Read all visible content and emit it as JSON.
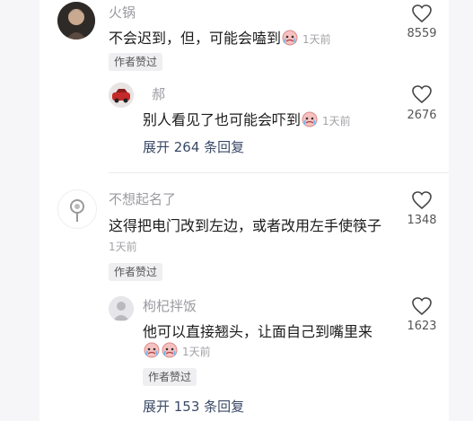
{
  "comments": [
    {
      "name": "火锅",
      "text": "不会迟到，但，可能会嗑到",
      "time": "1天前",
      "badge": "作者赞过",
      "likes": "8559",
      "avatar_icon": "user-photo-avatar",
      "reply": {
        "name": "郝",
        "text": "别人看见了也可能会吓到",
        "time": "1天前",
        "likes": "2676",
        "avatar_icon": "red-car-avatar"
      },
      "expand": "展开 264 条回复"
    },
    {
      "name": "不想起名了",
      "text": "这得把电门改到左边，或者改用左手使筷子",
      "time": "1天前",
      "badge": "作者赞过",
      "likes": "1348",
      "avatar_icon": "lollipop-avatar",
      "reply": {
        "name": "枸杞拌饭",
        "text": "他可以直接翘头，让面自己到嘴里来",
        "time": "1天前",
        "badge": "作者赞过",
        "likes": "1623",
        "avatar_icon": "default-user-avatar"
      },
      "expand": "展开 153 条回复"
    }
  ],
  "colors": {
    "background": "#f3f3f5",
    "panel": "#ffffff",
    "link": "#3a4a66",
    "muted": "#9a9aa0"
  }
}
